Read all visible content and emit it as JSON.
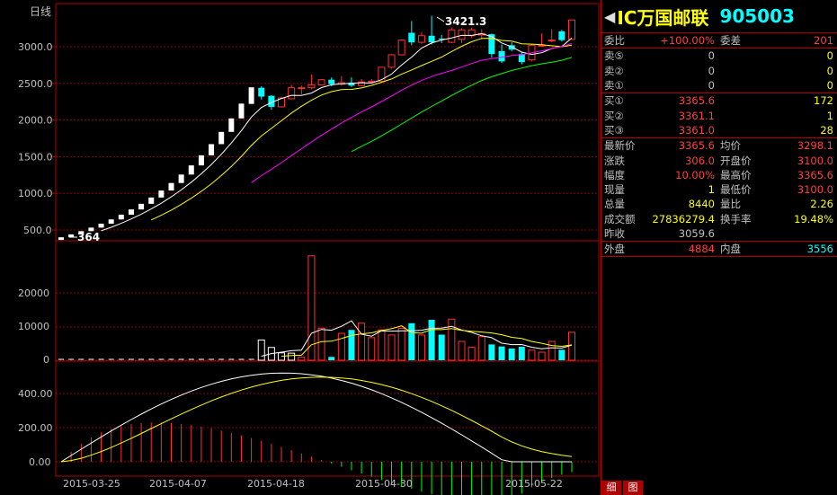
{
  "chart": {
    "period_label": "日线",
    "peak_annotation": "3421.3",
    "low_annotation": "364",
    "price_ticks": [
      "3000.0",
      "2500.0",
      "2000.0",
      "1500.0",
      "1000.0",
      "500.0"
    ],
    "volume_ticks": [
      "20000",
      "10000",
      "0"
    ],
    "macd_ticks": [
      "400.00",
      "200.00",
      "0.00"
    ],
    "dates": [
      "2015-03-25",
      "2015-04-07",
      "2015-04-18",
      "2015-04-30",
      "2015-05-22"
    ]
  },
  "chart_data": {
    "type": "candlestick",
    "price_ylim": [
      350,
      3450
    ],
    "ma_colors": {
      "ma5": "#ffffff",
      "ma10": "#ffff00",
      "ma20": "#ff00ff",
      "ma30": "#00ff00"
    },
    "candles": [
      {
        "o": 364,
        "h": 400,
        "l": 364,
        "c": 400,
        "up": true
      },
      {
        "o": 400,
        "h": 440,
        "l": 400,
        "c": 440,
        "up": true
      },
      {
        "o": 440,
        "h": 484,
        "l": 440,
        "c": 484,
        "up": true
      },
      {
        "o": 484,
        "h": 532,
        "l": 484,
        "c": 532,
        "up": true
      },
      {
        "o": 532,
        "h": 586,
        "l": 532,
        "c": 586,
        "up": true
      },
      {
        "o": 586,
        "h": 644,
        "l": 586,
        "c": 644,
        "up": true
      },
      {
        "o": 644,
        "h": 709,
        "l": 644,
        "c": 709,
        "up": true
      },
      {
        "o": 709,
        "h": 780,
        "l": 709,
        "c": 780,
        "up": true
      },
      {
        "o": 780,
        "h": 857,
        "l": 780,
        "c": 857,
        "up": true
      },
      {
        "o": 857,
        "h": 943,
        "l": 857,
        "c": 943,
        "up": true
      },
      {
        "o": 943,
        "h": 1038,
        "l": 943,
        "c": 1038,
        "up": true
      },
      {
        "o": 1038,
        "h": 1141,
        "l": 1038,
        "c": 1141,
        "up": true
      },
      {
        "o": 1141,
        "h": 1256,
        "l": 1141,
        "c": 1256,
        "up": true
      },
      {
        "o": 1256,
        "h": 1381,
        "l": 1256,
        "c": 1381,
        "up": true
      },
      {
        "o": 1381,
        "h": 1519,
        "l": 1381,
        "c": 1519,
        "up": true
      },
      {
        "o": 1519,
        "h": 1671,
        "l": 1519,
        "c": 1671,
        "up": true
      },
      {
        "o": 1671,
        "h": 1838,
        "l": 1671,
        "c": 1838,
        "up": true
      },
      {
        "o": 1838,
        "h": 2022,
        "l": 1838,
        "c": 2022,
        "up": true
      },
      {
        "o": 2022,
        "h": 2224,
        "l": 2022,
        "c": 2224,
        "up": true
      },
      {
        "o": 2220,
        "h": 2446,
        "l": 2220,
        "c": 2446,
        "up": true
      },
      {
        "o": 2440,
        "h": 2460,
        "l": 2280,
        "c": 2320,
        "up": false
      },
      {
        "o": 2330,
        "h": 2340,
        "l": 2140,
        "c": 2180,
        "up": false
      },
      {
        "o": 2180,
        "h": 2320,
        "l": 2170,
        "c": 2300,
        "up": true
      },
      {
        "o": 2290,
        "h": 2480,
        "l": 2280,
        "c": 2440,
        "up": true
      },
      {
        "o": 2440,
        "h": 2470,
        "l": 2350,
        "c": 2440,
        "up": true
      },
      {
        "o": 2440,
        "h": 2620,
        "l": 2420,
        "c": 2480,
        "up": true
      },
      {
        "o": 2480,
        "h": 2560,
        "l": 2480,
        "c": 2550,
        "up": true
      },
      {
        "o": 2550,
        "h": 2580,
        "l": 2460,
        "c": 2490,
        "up": false
      },
      {
        "o": 2490,
        "h": 2600,
        "l": 2470,
        "c": 2510,
        "up": true
      },
      {
        "o": 2510,
        "h": 2580,
        "l": 2450,
        "c": 2470,
        "up": false
      },
      {
        "o": 2470,
        "h": 2560,
        "l": 2460,
        "c": 2520,
        "up": true
      },
      {
        "o": 2520,
        "h": 2560,
        "l": 2500,
        "c": 2530,
        "up": true
      },
      {
        "o": 2530,
        "h": 2720,
        "l": 2520,
        "c": 2720,
        "up": true
      },
      {
        "o": 2720,
        "h": 2900,
        "l": 2700,
        "c": 2890,
        "up": true
      },
      {
        "o": 2890,
        "h": 3100,
        "l": 2880,
        "c": 3090,
        "up": true
      },
      {
        "o": 3190,
        "h": 3350,
        "l": 3020,
        "c": 3060,
        "up": false
      },
      {
        "o": 3060,
        "h": 3200,
        "l": 3040,
        "c": 3150,
        "up": true
      },
      {
        "o": 3150,
        "h": 3421.3,
        "l": 3030,
        "c": 3060,
        "up": false
      },
      {
        "o": 3110,
        "h": 3160,
        "l": 3050,
        "c": 3100,
        "up": false
      },
      {
        "o": 3060,
        "h": 3260,
        "l": 3050,
        "c": 3230,
        "up": true
      },
      {
        "o": 3100,
        "h": 3250,
        "l": 3050,
        "c": 3230,
        "up": true
      },
      {
        "o": 3230,
        "h": 3260,
        "l": 3120,
        "c": 3150,
        "up": true
      },
      {
        "o": 3160,
        "h": 3240,
        "l": 3100,
        "c": 3180,
        "up": true
      },
      {
        "o": 3170,
        "h": 3180,
        "l": 2850,
        "c": 2900,
        "up": false
      },
      {
        "o": 2940,
        "h": 3030,
        "l": 2780,
        "c": 2800,
        "up": false
      },
      {
        "o": 3020,
        "h": 3060,
        "l": 2940,
        "c": 2960,
        "up": false
      },
      {
        "o": 2900,
        "h": 2930,
        "l": 2760,
        "c": 2790,
        "up": false
      },
      {
        "o": 2820,
        "h": 3030,
        "l": 2800,
        "c": 3020,
        "up": true
      },
      {
        "o": 3010,
        "h": 3180,
        "l": 3000,
        "c": 3020,
        "up": true
      },
      {
        "o": 3080,
        "h": 3240,
        "l": 3060,
        "c": 3090,
        "up": true
      },
      {
        "o": 3210,
        "h": 3230,
        "l": 3070,
        "c": 3090,
        "up": false
      },
      {
        "o": 3100,
        "h": 3365.6,
        "l": 3100,
        "c": 3365.6,
        "up": true
      }
    ],
    "volumes": [
      0,
      0,
      0,
      0,
      0,
      0,
      0,
      0,
      100,
      0,
      0,
      0,
      0,
      0,
      0,
      0,
      0,
      0,
      0,
      0,
      0,
      0,
      0,
      0,
      0,
      0,
      0,
      0,
      0,
      0,
      0,
      0,
      0,
      0,
      0,
      0,
      0,
      0,
      0,
      0,
      0,
      0,
      0,
      0,
      0,
      0,
      0,
      0,
      0,
      0,
      0,
      0
    ],
    "volume_ylim": [
      0,
      32000
    ]
  },
  "quote": {
    "name": "IC万国邮联",
    "code": "905003",
    "wb_label": "委比",
    "wb_value": "+100.00%",
    "wc_label": "委差",
    "wc_value": "201",
    "sell5_label": "卖⑤",
    "sell5_price": "0",
    "sell5_vol": "0",
    "sell2_label": "卖②",
    "sell2_price": "0",
    "sell2_vol": "0",
    "sell1_label": "卖①",
    "sell1_price": "0",
    "sell1_vol": "0",
    "buy1_label": "买①",
    "buy1_price": "3365.6",
    "buy1_vol": "172",
    "buy2_label": "买②",
    "buy2_price": "3361.1",
    "buy2_vol": "1",
    "buy3_label": "买③",
    "buy3_price": "3361.0",
    "buy3_vol": "28",
    "latest_label": "最新价",
    "latest_value": "3365.6",
    "avg_label": "均价",
    "avg_value": "3298.1",
    "change_label": "涨跌",
    "change_value": "306.0",
    "open_label": "开盘价",
    "open_value": "3100.0",
    "pct_label": "幅度",
    "pct_value": "10.00%",
    "high_label": "最高价",
    "high_value": "3365.6",
    "cur_label": "现量",
    "cur_value": "1",
    "low_label": "最低价",
    "low_value": "3100.0",
    "total_label": "总量",
    "total_value": "8440",
    "ratio_label": "量比",
    "ratio_value": "2.26",
    "amount_label": "成交额",
    "amount_value": "27836279.4",
    "turnover_label": "换手率",
    "turnover_value": "19.48%",
    "prev_label": "昨收",
    "prev_value": "3059.6",
    "outer_label": "外盘",
    "outer_value": "4884",
    "inner_label": "内盘",
    "inner_value": "3556"
  },
  "tabs": [
    "细",
    "图"
  ]
}
